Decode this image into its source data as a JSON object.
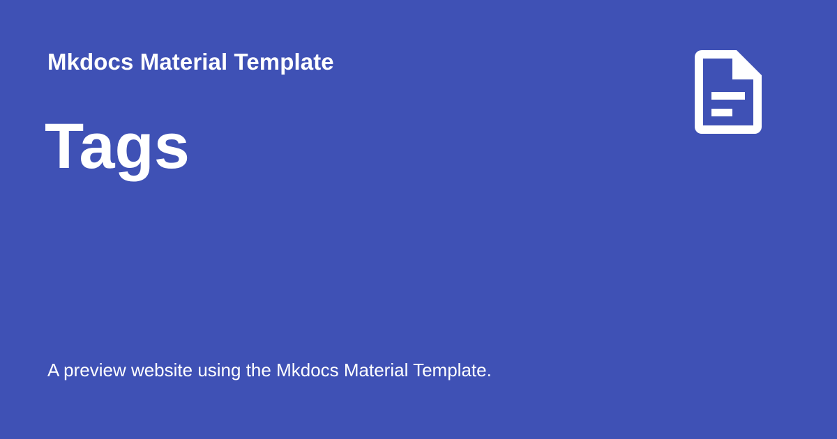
{
  "site": {
    "name": "Mkdocs Material Template"
  },
  "page": {
    "title": "Tags",
    "description": "A preview website using the Mkdocs Material Template."
  },
  "icon": {
    "name": "file-document-icon",
    "color": "#ffffff"
  },
  "colors": {
    "background": "#3f51b5",
    "text": "#ffffff"
  }
}
